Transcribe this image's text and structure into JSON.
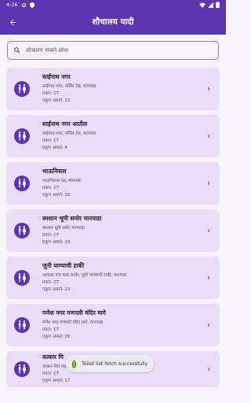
{
  "status_bar": {
    "time": "4:26"
  },
  "app_bar": {
    "title": "शौचालय यादी"
  },
  "search": {
    "placeholder": "शौचालय नावाने शोधा"
  },
  "toilets": [
    {
      "name": "साईनाथ नगर",
      "address": "साईनाथ नगर, वर्सिस रोड, मानपाडा",
      "type": "प्रकार: CT",
      "seats": "एकूण आसने: 12"
    },
    {
      "name": "साईनाथ नगर आतील",
      "address": "साईनाथ नगर, वर्सिस रोड, मानपाडा",
      "type": "प्रकार: CT",
      "seats": "एकूण आसने: 4"
    },
    {
      "name": "भाऊनिवास",
      "address": "भाऊनिवास चंद्र, मानपाडा",
      "type": "प्रकार: CT",
      "seats": "एकूण आसने: 19"
    },
    {
      "name": "स्मशान भूमी समोर मानपाडा",
      "address": "स्मशान भूमी समोर मानपाडा",
      "type": "प्रकार: CT",
      "seats": "एकूण आसने: 19"
    },
    {
      "name": "जुनी पाण्याची टाकी",
      "address": "आकाश गंगा पाक समोर, जुनी पाण्याची टाकी, मानपाडा",
      "type": "प्रकार: CT",
      "seats": "एकूण आसने: 23"
    },
    {
      "name": "गणेश नगर गणपती मंदिर मागे",
      "address": "गणेश नगर गणपती मंदिर मागे, मानपाडा",
      "type": "प्रकार: CT",
      "seats": "एकूण आसने: 20"
    },
    {
      "name": "सत्कार मि",
      "address": "सत्कार मित्र मंडळ, मानपाडा",
      "type": "प्रकार: CT",
      "seats": "एकूण आसने: 17"
    }
  ],
  "toast": {
    "message": "Toilet list fetch successfully"
  },
  "colors": {
    "primary": "#5e35b1",
    "card_bg": "#e8def8",
    "page_bg": "#f7f3fa"
  }
}
